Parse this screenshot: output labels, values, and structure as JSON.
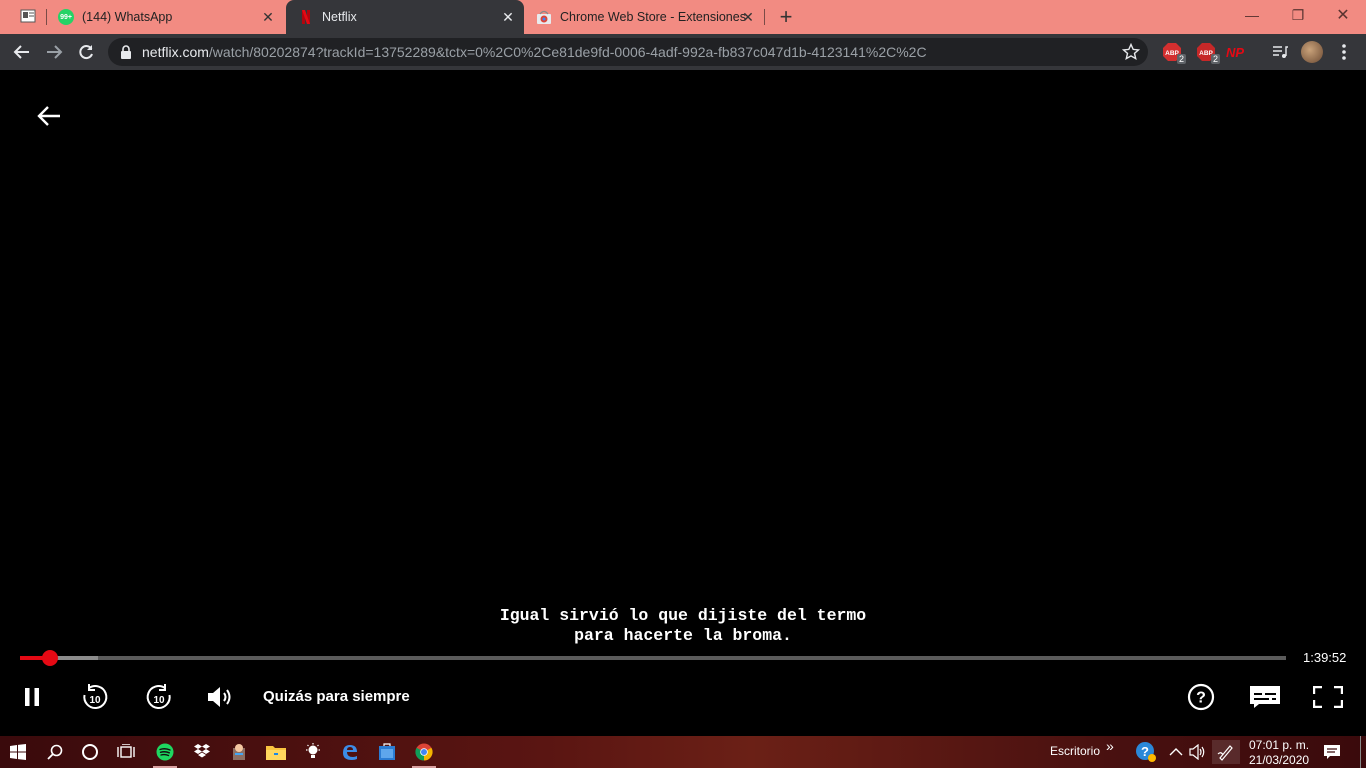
{
  "browser": {
    "tabs": [
      {
        "label": "",
        "favicon": "pinned-app-icon"
      },
      {
        "label": "(144) WhatsApp",
        "favicon": "whatsapp-icon",
        "favicon_badge": "99+"
      },
      {
        "label": "Netflix",
        "favicon": "netflix-icon",
        "active": true
      },
      {
        "label": "Chrome Web Store - Extensiones",
        "favicon": "chrome-web-store-icon"
      }
    ],
    "new_tab_label": "+",
    "url_domain": "netflix.com",
    "url_path": "/watch/80202874?trackId=13752289&tctx=0%2C0%2Ce81de9fd-0006-4adf-992a-fb837c047d1b-4123141%2C%2C",
    "extensions": [
      {
        "name": "adblock-icon",
        "badge": "2"
      },
      {
        "name": "adblock-plus-icon",
        "badge": "2"
      },
      {
        "name": "netflix-party-icon",
        "label": "NP"
      }
    ],
    "colors": {
      "tab_strip": "#f28b82",
      "toolbar": "#35363a",
      "omnibox": "#202124"
    }
  },
  "player": {
    "subtitle_lines": [
      "Igual sirvió lo que dijiste del termo",
      "para hacerte la broma."
    ],
    "time_remaining": "1:39:52",
    "title": "Quizás para siempre",
    "progress_fraction": 0.024,
    "buffer_fraction": 0.062,
    "accent_color": "#e50914",
    "controls": [
      "pause-icon",
      "rewind-10-icon",
      "forward-10-icon",
      "volume-icon",
      "help-icon",
      "subtitles-icon",
      "fullscreen-icon"
    ],
    "rewind_label": "10",
    "forward_label": "10"
  },
  "taskbar": {
    "apps": [
      "windows-start-icon",
      "search-icon",
      "cortana-icon",
      "task-view-icon",
      "spotify-icon",
      "dropbox-icon",
      "app-icon",
      "file-explorer-icon",
      "tips-icon",
      "edge-icon",
      "store-icon",
      "chrome-icon"
    ],
    "desktop_label": "Escritorio",
    "desktop_chevron": "»",
    "time": "07:01 p. m.",
    "date": "21/03/2020"
  }
}
